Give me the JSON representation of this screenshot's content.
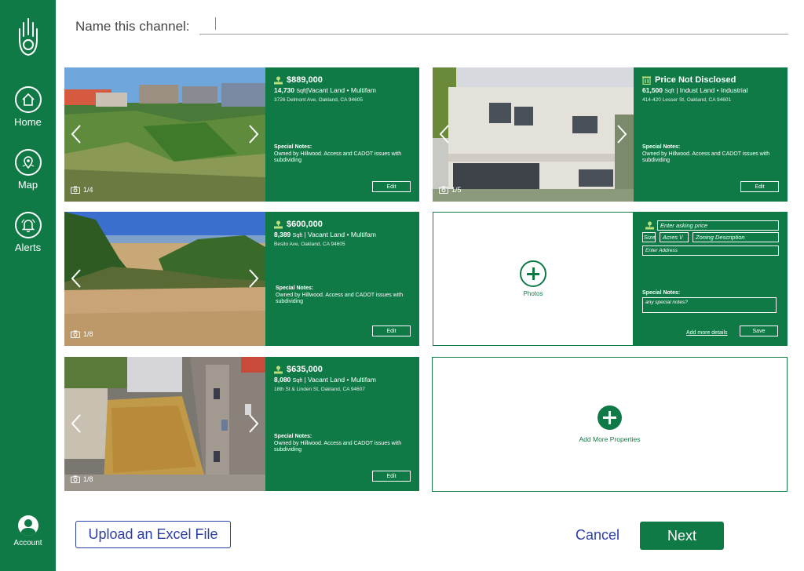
{
  "colors": {
    "brand_green": "#0f7a46",
    "link_blue": "#2a3ea8"
  },
  "sidebar": {
    "logo_icon": "hand-logo-icon",
    "items": [
      {
        "label": "Home",
        "icon": "home-icon"
      },
      {
        "label": "Map",
        "icon": "map-pin-icon"
      },
      {
        "label": "Alerts",
        "icon": "bell-icon"
      }
    ],
    "account": {
      "label": "Account",
      "icon": "user-avatar-icon"
    }
  },
  "header": {
    "channel_label": "Name this channel:",
    "channel_value": ""
  },
  "properties": [
    {
      "price": "$889,000",
      "sqft": "14,730",
      "sqft_unit": "Sqft",
      "type": "Vacant Land",
      "use": "Multifam",
      "address": "3726 Delmont Ave, Oakland, CA 94605",
      "notes_heading": "Special Notes:",
      "notes": "Owned by Hillwood. Access and CADOT issues with subdividing",
      "photo_counter": "1/4",
      "edit_label": "Edit",
      "icon": "land-icon"
    },
    {
      "price": "Price Not Disclosed",
      "sqft": "61,500",
      "sqft_unit": "Sqft",
      "type": "Indust Land",
      "use": "Industrial",
      "address": "414-420 Lesser St, Oakland, CA 94601",
      "notes_heading": "Special Notes:",
      "notes": "Owned by Hillwood. Access and CADOT issues with subdividing",
      "photo_counter": "1/5",
      "edit_label": "Edit",
      "icon": "building-icon"
    },
    {
      "price": "$600,000",
      "sqft": "8,389",
      "sqft_unit": "Sqft",
      "type": "Vacant Land",
      "use": "Multifam",
      "address": "Besito Ave, Oakland, CA 94605",
      "notes_heading": "Special Notes:",
      "notes": "Owned by Hillwood. Access and CADOT issues with subdividing",
      "photo_counter": "1/8",
      "edit_label": "Edit",
      "icon": "land-icon"
    },
    {
      "price": "$635,000",
      "sqft": "8,080",
      "sqft_unit": "Sqft",
      "type": "Vacant Land",
      "use": "Multifam",
      "address": "18th St & Linden St, Oakland, CA 94607",
      "notes_heading": "Special Notes:",
      "notes": "Owned by Hillwood. Access and CADOT issues with subdividing",
      "photo_counter": "1/8",
      "edit_label": "Edit",
      "icon": "land-icon"
    }
  ],
  "new_property": {
    "photos_label": "Photos",
    "price_placeholder": "Enter asking price",
    "size_label": "Size",
    "unit_value": "Acres \\/",
    "zoning_placeholder": "Zoning Description",
    "address_placeholder": "Enter Address",
    "notes_heading": "Special Notes:",
    "notes_placeholder": "any special notes?",
    "add_details_link": "Add more details",
    "save_label": "Save"
  },
  "add_more_label": "Add More Properties",
  "footer": {
    "upload_label": "Upload an Excel File",
    "cancel_label": "Cancel",
    "next_label": "Next"
  }
}
